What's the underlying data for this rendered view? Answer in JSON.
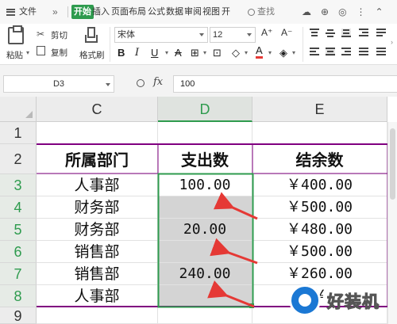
{
  "menubar": {
    "file": "文件",
    "expand": "»",
    "tabs": [
      "开始",
      "插入",
      "页面布局",
      "公式",
      "数据",
      "审阅",
      "视图",
      "开"
    ],
    "search": "查找"
  },
  "ribbon": {
    "paste": "粘贴",
    "cut": "剪切",
    "copy": "复制",
    "format_painter": "格式刷",
    "font_name": "宋体",
    "font_size": "12",
    "grow": "A⁺",
    "shrink": "A⁻"
  },
  "formula_bar": {
    "cell_ref": "D3",
    "fx": "fx",
    "value": "100"
  },
  "columns": [
    "C",
    "D",
    "E"
  ],
  "rows": [
    "1",
    "2",
    "3",
    "4",
    "5",
    "6",
    "7",
    "8",
    "9"
  ],
  "table": {
    "header": [
      "所属部门",
      "支出数",
      "结余数"
    ],
    "data": [
      [
        "人事部",
        "100.00",
        "￥400.00"
      ],
      [
        "财务部",
        "",
        "￥500.00"
      ],
      [
        "财务部",
        "20.00",
        "￥480.00"
      ],
      [
        "销售部",
        "",
        "￥500.00"
      ],
      [
        "销售部",
        "240.00",
        "￥260.00"
      ],
      [
        "人事部",
        "",
        "￥"
      ]
    ]
  },
  "watermark": {
    "text": "好装机"
  },
  "colors": {
    "accent_green": "#2e9b4e",
    "header_border": "#800080",
    "arrow_red": "#e53935",
    "gray_fill": "#d4d4d4"
  }
}
